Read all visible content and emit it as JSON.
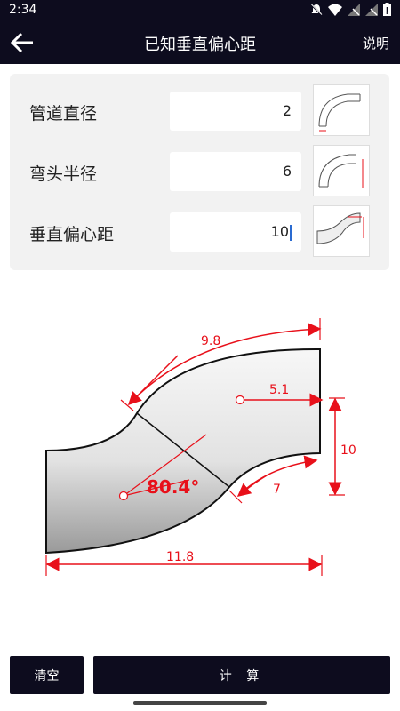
{
  "status": {
    "time": "2:34"
  },
  "app_bar": {
    "title": "已知垂直偏心距",
    "help": "说明"
  },
  "form": {
    "rows": [
      {
        "label": "管道直径",
        "value": "2",
        "thumb": "pipe-diameter-diagram"
      },
      {
        "label": "弯头半径",
        "value": "6",
        "thumb": "elbow-radius-diagram"
      },
      {
        "label": "垂直偏心距",
        "value": "10",
        "thumb": "vertical-offset-diagram"
      }
    ]
  },
  "diagram": {
    "angle": "80.4°",
    "top_length": "9.8",
    "horizontal_offset": "5.1",
    "vertical_offset": "10",
    "lower_arc": "7",
    "bottom_length": "11.8",
    "accent_color": "#e8101a"
  },
  "buttons": {
    "clear": "清空",
    "calc": "计 算"
  }
}
